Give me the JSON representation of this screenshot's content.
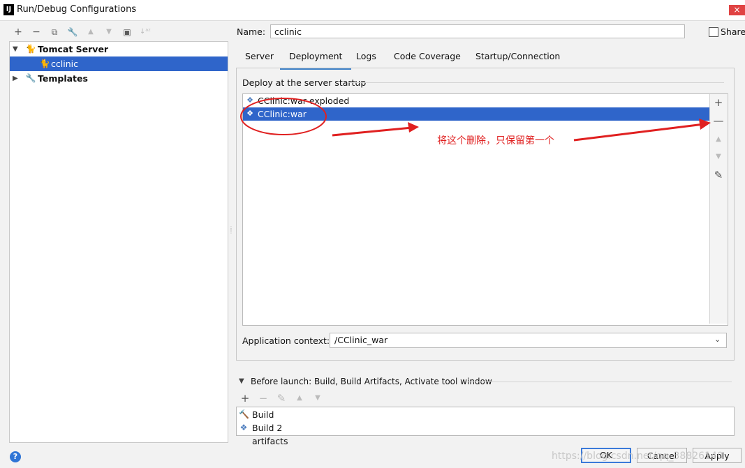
{
  "window": {
    "title": "Run/Debug Configurations",
    "close": "×",
    "app_icon": "IJ"
  },
  "toolbar": {
    "add": "+",
    "remove": "−",
    "copy": "⧉",
    "edit": "🔧",
    "up": "▲",
    "down": "▼",
    "folder": "▣",
    "sort": "↓ᵃᶻ"
  },
  "tree": {
    "items": [
      {
        "label": "Tomcat Server",
        "icon": "tomcat-icon",
        "expanded": true
      },
      {
        "label": "cclinic",
        "icon": "tomcat-icon",
        "selected": true
      },
      {
        "label": "Templates",
        "icon": "wrench-icon",
        "expanded": false
      }
    ]
  },
  "config": {
    "name_label": "Name:",
    "name_value": "cclinic",
    "share_label": "Share",
    "share_checked": false
  },
  "tabs": [
    {
      "label": "Server"
    },
    {
      "label": "Deployment",
      "active": true
    },
    {
      "label": "Logs"
    },
    {
      "label": "Code Coverage"
    },
    {
      "label": "Startup/Connection"
    }
  ],
  "deployment": {
    "section_label": "Deploy at the server startup",
    "items": [
      {
        "label": "CClinic:war exploded",
        "selected": false
      },
      {
        "label": "CClinic:war",
        "selected": true
      }
    ],
    "side_tools": {
      "add": "+",
      "remove": "—",
      "up": "▲",
      "down": "▼",
      "edit": "✎"
    },
    "context_label": "Application context:",
    "context_value": "/CClinic_war"
  },
  "before_launch": {
    "label": "Before launch: Build, Build Artifacts, Activate tool window",
    "tools": {
      "add": "+",
      "remove": "−",
      "edit": "✎",
      "up": "▲",
      "down": "▼"
    },
    "items": [
      {
        "label": "Build",
        "icon": "hammer-icon"
      },
      {
        "label": "Build 2 artifacts",
        "icon": "artifact-icon"
      }
    ]
  },
  "buttons": {
    "help": "?",
    "ok": "OK",
    "cancel": "Cancel",
    "apply": "Apply"
  },
  "annotation": {
    "text": "将这个删除，只保留第一个",
    "color": "#e02020"
  },
  "watermark": "https://blog.csdn.net/qq_38826140"
}
